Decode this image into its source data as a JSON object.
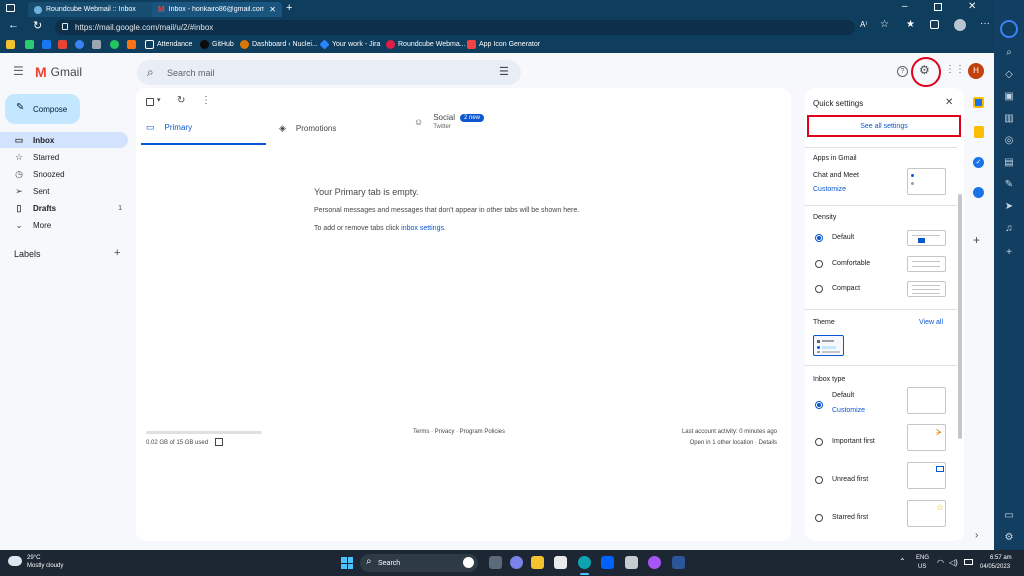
{
  "browser": {
    "tabs": [
      {
        "title": "Roundcube Webmail :: Inbox"
      },
      {
        "title": "Inbox - honkairo86@gmail.com"
      }
    ],
    "url": "https://mail.google.com/mail/u/2/#inbox",
    "bookmarks": [
      "Attendance",
      "GitHub",
      "Dashboard ‹ Nuclei...",
      "Your work - Jira",
      "Roundcube Webma...",
      "App Icon Generator"
    ]
  },
  "gmail": {
    "logo_text": "Gmail",
    "search_placeholder": "Search mail",
    "avatar_letter": "H",
    "compose_label": "Compose",
    "nav": [
      {
        "label": "Inbox",
        "icon": "inbox-icon"
      },
      {
        "label": "Starred",
        "icon": "star-icon"
      },
      {
        "label": "Snoozed",
        "icon": "clock-icon"
      },
      {
        "label": "Sent",
        "icon": "send-icon"
      },
      {
        "label": "Drafts",
        "icon": "draft-icon",
        "count": "1"
      },
      {
        "label": "More",
        "icon": "chevron-down-icon"
      }
    ],
    "labels_heading": "Labels",
    "tabs": {
      "primary": "Primary",
      "promotions": "Promotions",
      "social": "Social",
      "social_badge": "2 new",
      "social_sub": "Twitter"
    },
    "empty": {
      "title": "Your Primary tab is empty.",
      "desc": "Personal messages and messages that don't appear in other tabs will be shown here.",
      "hint_prefix": "To add or remove tabs click ",
      "hint_link": "inbox settings",
      "hint_suffix": "."
    },
    "footer": {
      "storage": "0.02 GB of 15 GB used",
      "links": "Terms · Privacy · Program Policies",
      "activity": "Last account activity: 0 minutes ago",
      "details": "Open in 1 other location · Details"
    }
  },
  "quick_settings": {
    "title": "Quick settings",
    "see_all": "See all settings",
    "apps_heading": "Apps in Gmail",
    "chat_meet": "Chat and Meet",
    "customize": "Customize",
    "density_heading": "Density",
    "density_options": [
      "Default",
      "Comfortable",
      "Compact"
    ],
    "theme_heading": "Theme",
    "view_all": "View all",
    "inbox_type_heading": "Inbox type",
    "inbox_options": [
      "Default",
      "Important first",
      "Unread first",
      "Starred first"
    ]
  },
  "taskbar": {
    "weather_temp": "29°C",
    "weather_desc": "Mostly cloudy",
    "search_label": "Search",
    "lang": "ENG",
    "region": "US",
    "time": "6:57 am",
    "date": "04/05/2023"
  },
  "colors": {
    "accent": "#0b57d0",
    "compose": "#c2e7ff",
    "highlight": "#e0001b"
  }
}
